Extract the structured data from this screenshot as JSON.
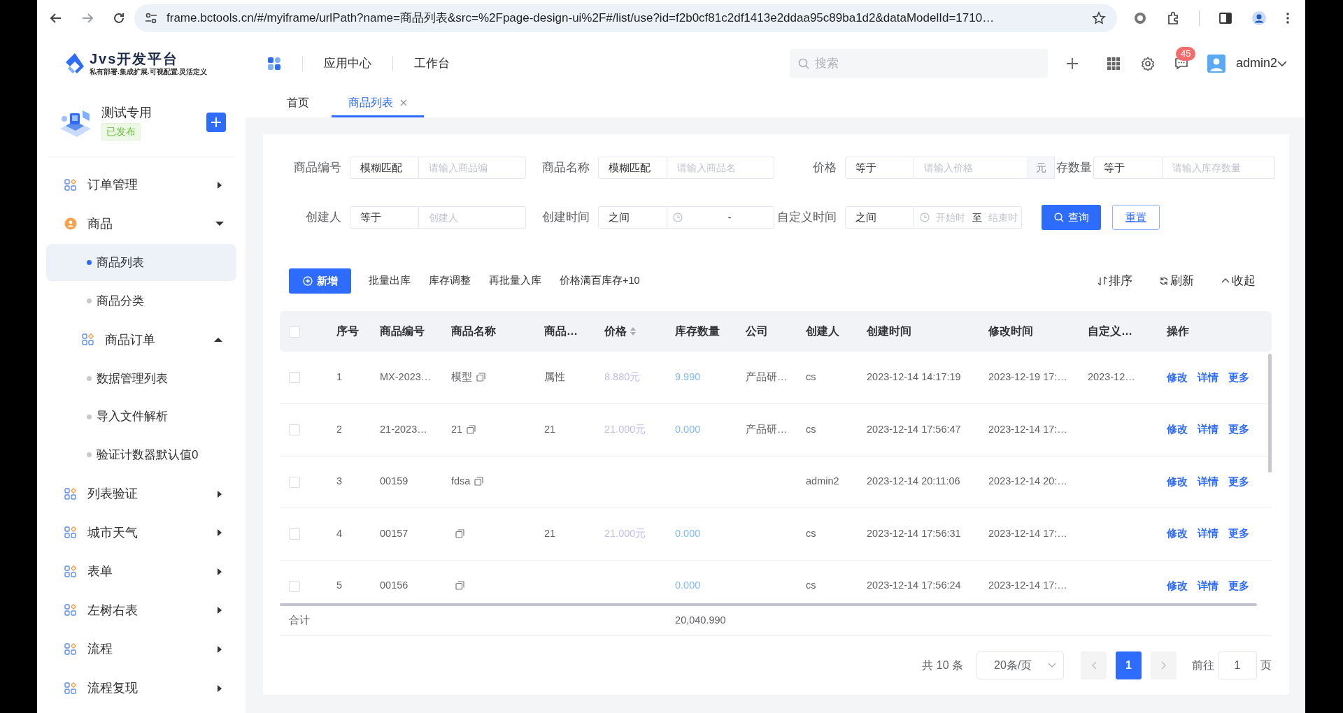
{
  "browser": {
    "url": "frame.bctools.cn/#/myiframe/urlPath?name=商品列表&src=%2Fpage-design-ui%2F#/list/use?id=f2b0cf81c2df1413e2ddaa95c89ba1d2&dataModelId=1710…"
  },
  "header": {
    "logo_title": "Jvs开发平台",
    "logo_tagline": "私有部署.集成扩展.可视配置.灵活定义",
    "nav": [
      "应用中心",
      "工作台"
    ],
    "search_placeholder": "搜索",
    "message_count": "45",
    "user": "admin2"
  },
  "tabs": [
    {
      "label": "首页",
      "selected": false,
      "closable": false
    },
    {
      "label": "商品列表",
      "selected": true,
      "closable": true
    }
  ],
  "sidebar": {
    "app_name": "测试专用",
    "status": "已发布",
    "menu": [
      {
        "label": "订单管理",
        "kind": "group",
        "expanded": false
      },
      {
        "label": "商品",
        "kind": "app",
        "expanded": true,
        "children": [
          {
            "label": "商品列表",
            "kind": "leaf",
            "selected": true
          },
          {
            "label": "商品分类",
            "kind": "leaf",
            "selected": false
          },
          {
            "label": "商品订单",
            "kind": "group",
            "expanded": true,
            "children": [
              {
                "label": "数据管理列表",
                "kind": "leaf",
                "selected": false
              },
              {
                "label": "导入文件解析",
                "kind": "leaf",
                "selected": false
              },
              {
                "label": "验证计数器默认值0",
                "kind": "leaf",
                "selected": false
              }
            ]
          }
        ]
      },
      {
        "label": "列表验证",
        "kind": "group",
        "expanded": false
      },
      {
        "label": "城市天气",
        "kind": "group",
        "expanded": false
      },
      {
        "label": "表单",
        "kind": "group",
        "expanded": false
      },
      {
        "label": "左树右表",
        "kind": "group",
        "expanded": false
      },
      {
        "label": "流程",
        "kind": "group",
        "expanded": false
      },
      {
        "label": "流程复现",
        "kind": "group",
        "expanded": false
      }
    ]
  },
  "filters": [
    [
      {
        "label": "商品编号",
        "operator": "模糊匹配",
        "kind": "text",
        "placeholder": "请输入商品编"
      },
      {
        "label": "商品名称",
        "operator": "模糊匹配",
        "kind": "text",
        "placeholder": "请输入商品名"
      },
      {
        "label": "价格",
        "operator": "等于",
        "kind": "text",
        "placeholder": "请输入价格",
        "suffix": "元"
      },
      {
        "label": "存数量",
        "operator": "等于",
        "kind": "text",
        "placeholder": "请输入库存数量"
      }
    ],
    [
      {
        "label": "创建人",
        "operator": "等于",
        "kind": "text",
        "placeholder": "创建人"
      },
      {
        "label": "创建时间",
        "operator": "之间",
        "kind": "range",
        "separator": "-"
      },
      {
        "label": "自定义时间",
        "operator": "之间",
        "kind": "range",
        "start_placeholder": "开始时",
        "separator": "至",
        "end_placeholder": "结束时"
      }
    ]
  ],
  "search_button": "查询",
  "reset_button": "重置",
  "toolbar": {
    "primary": "新增",
    "actions": [
      "批量出库",
      "库存调整",
      "再批量入库",
      "价格满百库存+10"
    ],
    "tools": [
      {
        "label": "排序",
        "kind": "sort"
      },
      {
        "label": "刷新",
        "kind": "refresh"
      },
      {
        "label": "收起",
        "kind": "collapse"
      }
    ]
  },
  "table": {
    "all_checked": false,
    "columns": [
      {
        "label": "序号",
        "kind": "text"
      },
      {
        "label": "商品编号",
        "kind": "text"
      },
      {
        "label": "商品名称",
        "kind": "copy"
      },
      {
        "label": "商品…",
        "kind": "text"
      },
      {
        "label": "价格",
        "kind": "price",
        "sortable": true
      },
      {
        "label": "库存数量",
        "kind": "stock"
      },
      {
        "label": "公司",
        "kind": "text"
      },
      {
        "label": "创建人",
        "kind": "text"
      },
      {
        "label": "创建时间",
        "kind": "text"
      },
      {
        "label": "修改时间",
        "kind": "text"
      },
      {
        "label": "自定义…",
        "kind": "text"
      },
      {
        "label": "操作",
        "kind": "actions"
      }
    ],
    "rows": [
      {
        "checked": false,
        "cells": [
          "1",
          "MX-2023…",
          "模型",
          "属性",
          "8.880元",
          "9.990",
          "产品研…",
          "cs",
          "2023-12-14 14:17:19",
          "2023-12-19 17:…",
          "2023-12…"
        ],
        "actions": [
          "修改",
          "详情",
          "更多"
        ]
      },
      {
        "checked": false,
        "cells": [
          "2",
          "21-2023…",
          "21",
          "21",
          "21.000元",
          "0.000",
          "产品研…",
          "cs",
          "2023-12-14 17:56:47",
          "2023-12-14 17:…",
          null
        ],
        "actions": [
          "修改",
          "详情",
          "更多"
        ]
      },
      {
        "checked": false,
        "cells": [
          "3",
          "00159",
          "fdsa",
          null,
          null,
          null,
          null,
          "admin2",
          "2023-12-14 20:11:06",
          "2023-12-14 20:…",
          null
        ],
        "actions": [
          "修改",
          "详情",
          "更多"
        ]
      },
      {
        "checked": false,
        "cells": [
          "4",
          "00157",
          null,
          "21",
          "21.000元",
          "0.000",
          null,
          "cs",
          "2023-12-14 17:56:31",
          "2023-12-14 17:…",
          null
        ],
        "actions": [
          "修改",
          "详情",
          "更多"
        ]
      },
      {
        "checked": false,
        "cells": [
          "5",
          "00156",
          null,
          null,
          null,
          "0.000",
          null,
          "cs",
          "2023-12-14 17:56:24",
          "2023-12-14 17:…",
          null
        ],
        "actions": [
          "修改",
          "详情",
          "更多"
        ]
      }
    ],
    "summary": {
      "label": "合计",
      "stock_total": "20,040.990"
    }
  },
  "pagination": {
    "total": "共 10 条",
    "page_size": "20条/页",
    "pages": [
      {
        "label": "1",
        "selected": true
      }
    ],
    "prev_disabled": true,
    "next_disabled": true,
    "goto_label": "前往",
    "goto_value": "1",
    "goto_suffix": "页"
  }
}
